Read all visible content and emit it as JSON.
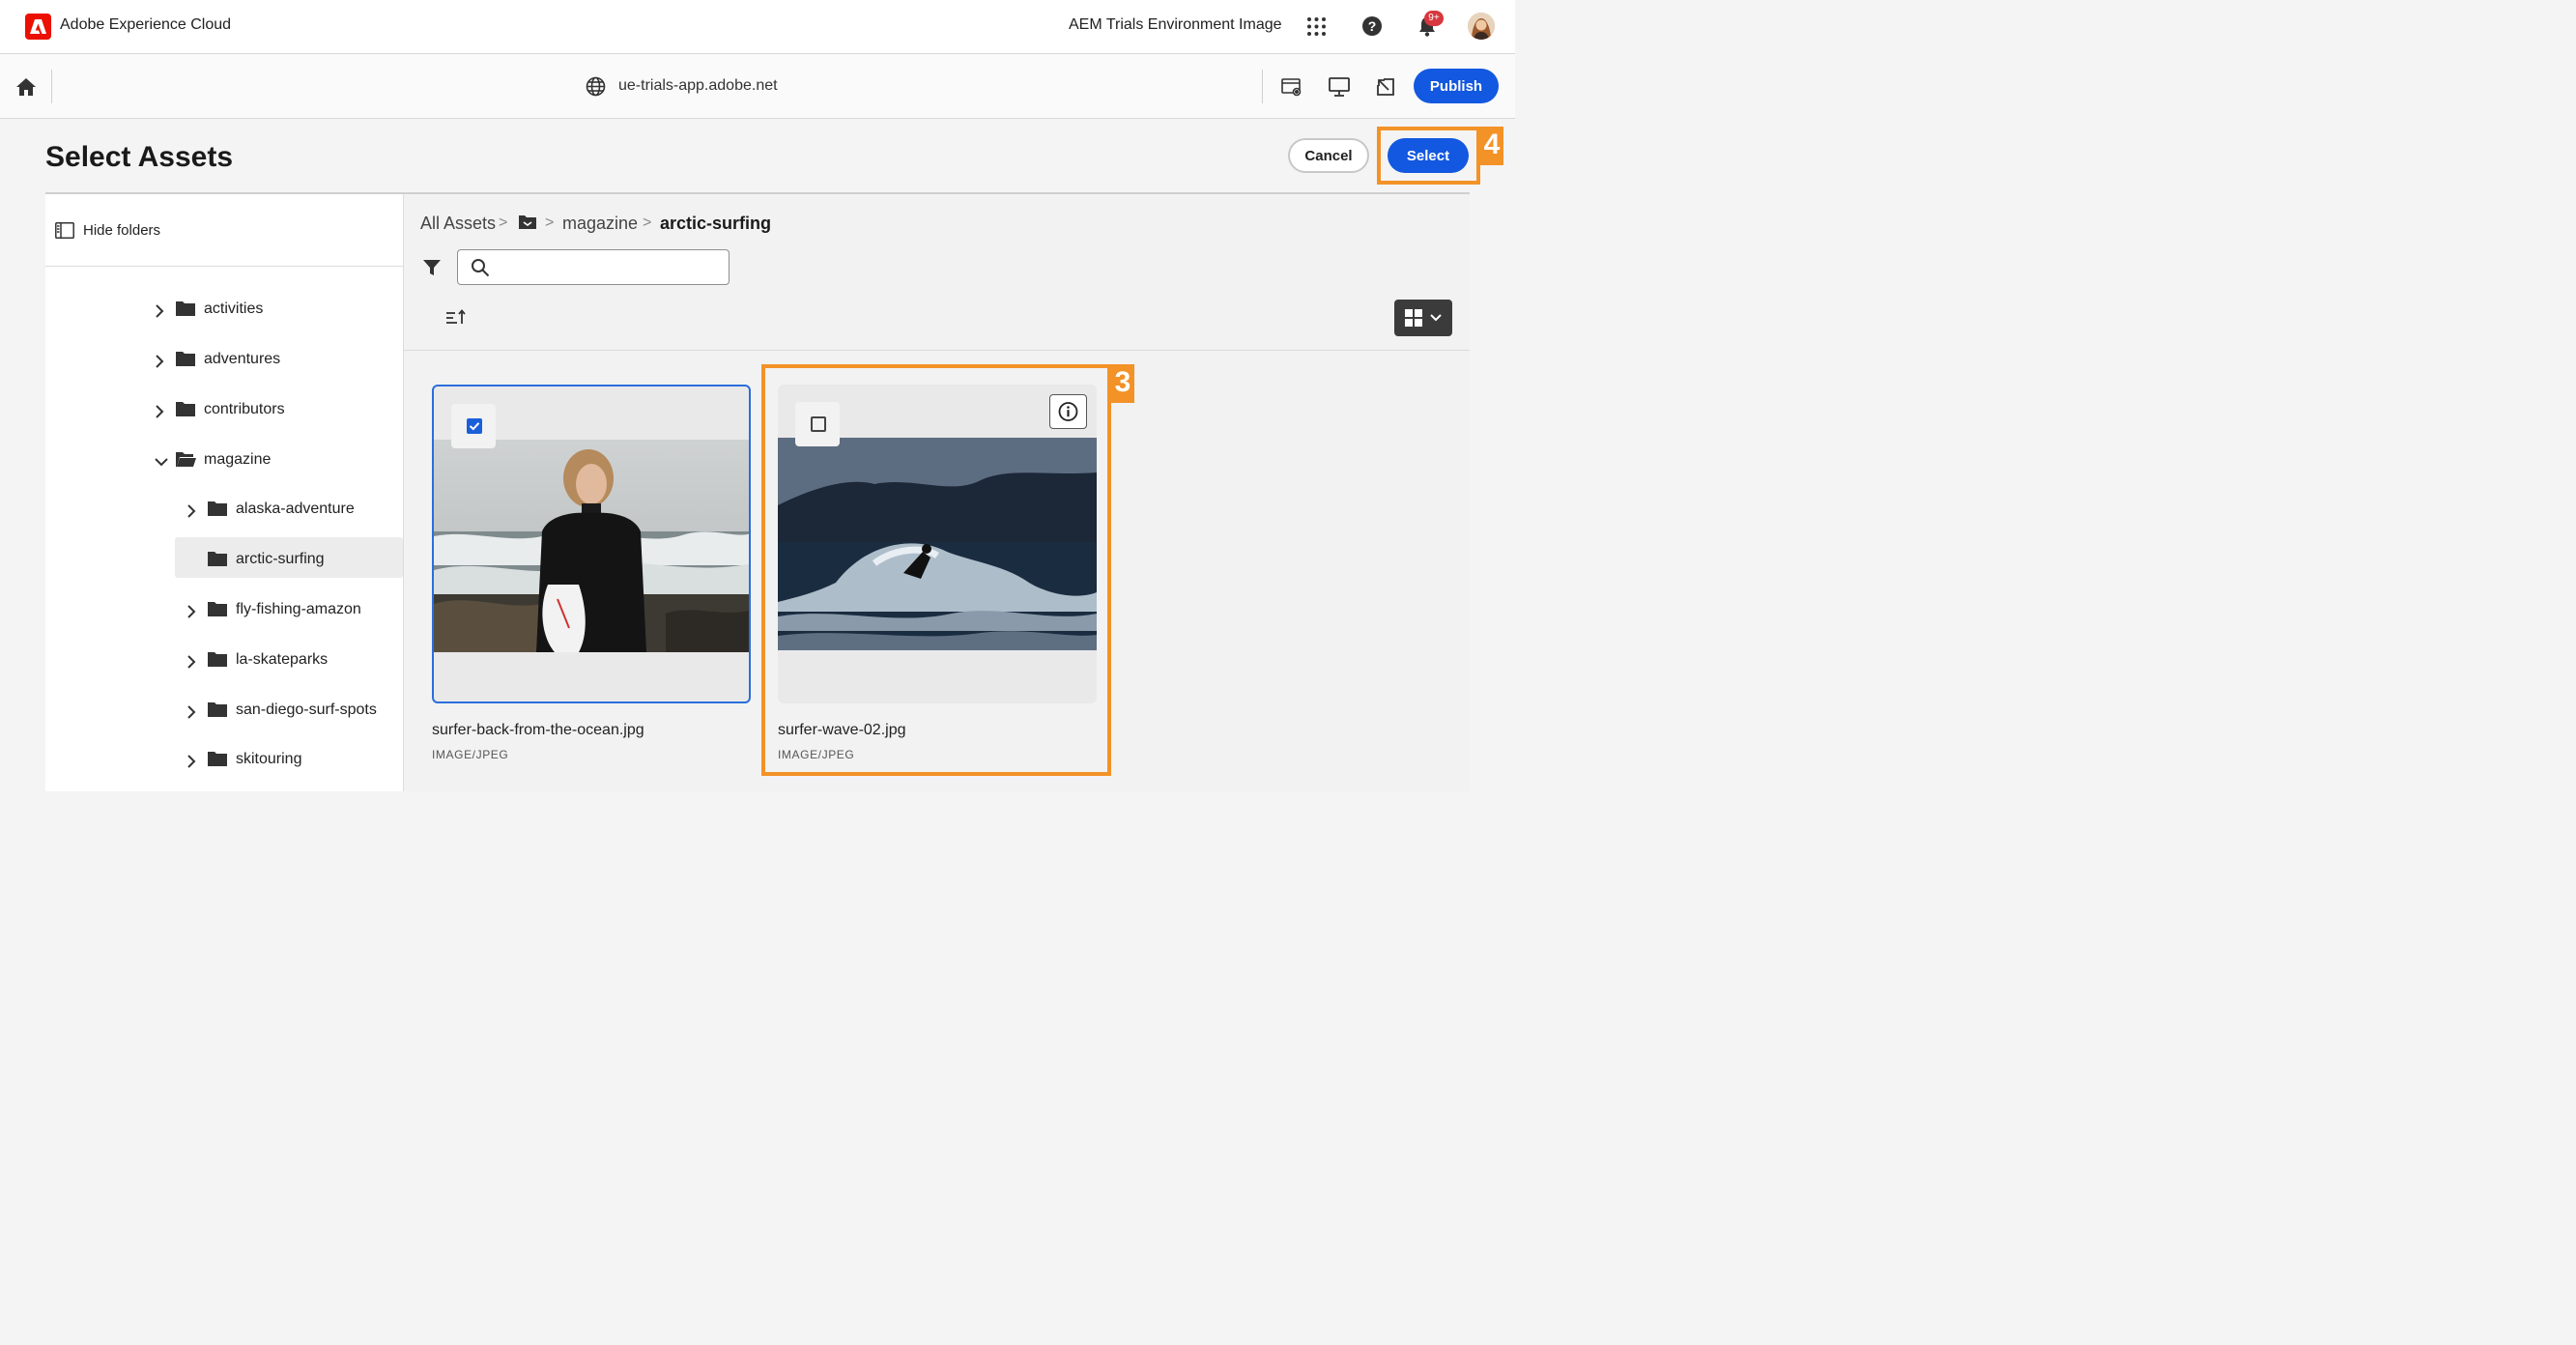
{
  "shell": {
    "title": "Adobe Experience Cloud",
    "environment": "AEM Trials Environment Image",
    "notification_badge": "9+",
    "icons": [
      "adobe-logo",
      "apps-grid-icon",
      "help-icon",
      "bell-icon",
      "avatar"
    ]
  },
  "editor_bar": {
    "url": "ue-trials-app.adobe.net",
    "publish_label": "Publish",
    "icons": [
      "home-icon",
      "globe-icon",
      "page-properties-icon",
      "preview-icon",
      "open-external-icon"
    ]
  },
  "dialog": {
    "title": "Select Assets",
    "cancel_label": "Cancel",
    "select_label": "Select",
    "hide_folders_label": "Hide folders"
  },
  "tree": [
    {
      "label": "activities",
      "expanded": false,
      "selected": false
    },
    {
      "label": "adventures",
      "expanded": false,
      "selected": false
    },
    {
      "label": "contributors",
      "expanded": false,
      "selected": false
    },
    {
      "label": "magazine",
      "expanded": true,
      "selected": false
    },
    {
      "label": "alaska-adventure",
      "expanded": false,
      "selected": false
    },
    {
      "label": "arctic-surfing",
      "expanded": false,
      "selected": true
    },
    {
      "label": "fly-fishing-amazon",
      "expanded": false,
      "selected": false
    },
    {
      "label": "la-skateparks",
      "expanded": false,
      "selected": false
    },
    {
      "label": "san-diego-surf-spots",
      "expanded": false,
      "selected": false
    },
    {
      "label": "skitouring",
      "expanded": false,
      "selected": false
    }
  ],
  "breadcrumb": {
    "root": "All Assets",
    "sep": ">",
    "middle": "magazine",
    "current": "arctic-surfing"
  },
  "search": {
    "value": "",
    "placeholder": ""
  },
  "assets": [
    {
      "name": "surfer-back-from-the-ocean.jpg",
      "type": "IMAGE/JPEG",
      "checked": true
    },
    {
      "name": "surfer-wave-02.jpg",
      "type": "IMAGE/JPEG",
      "checked": false
    }
  ],
  "annotations": {
    "step_select": "4",
    "step_card": "3",
    "color": "#f39227"
  },
  "colors": {
    "accent": "#1258e0",
    "adobe_red": "#eb1000"
  }
}
